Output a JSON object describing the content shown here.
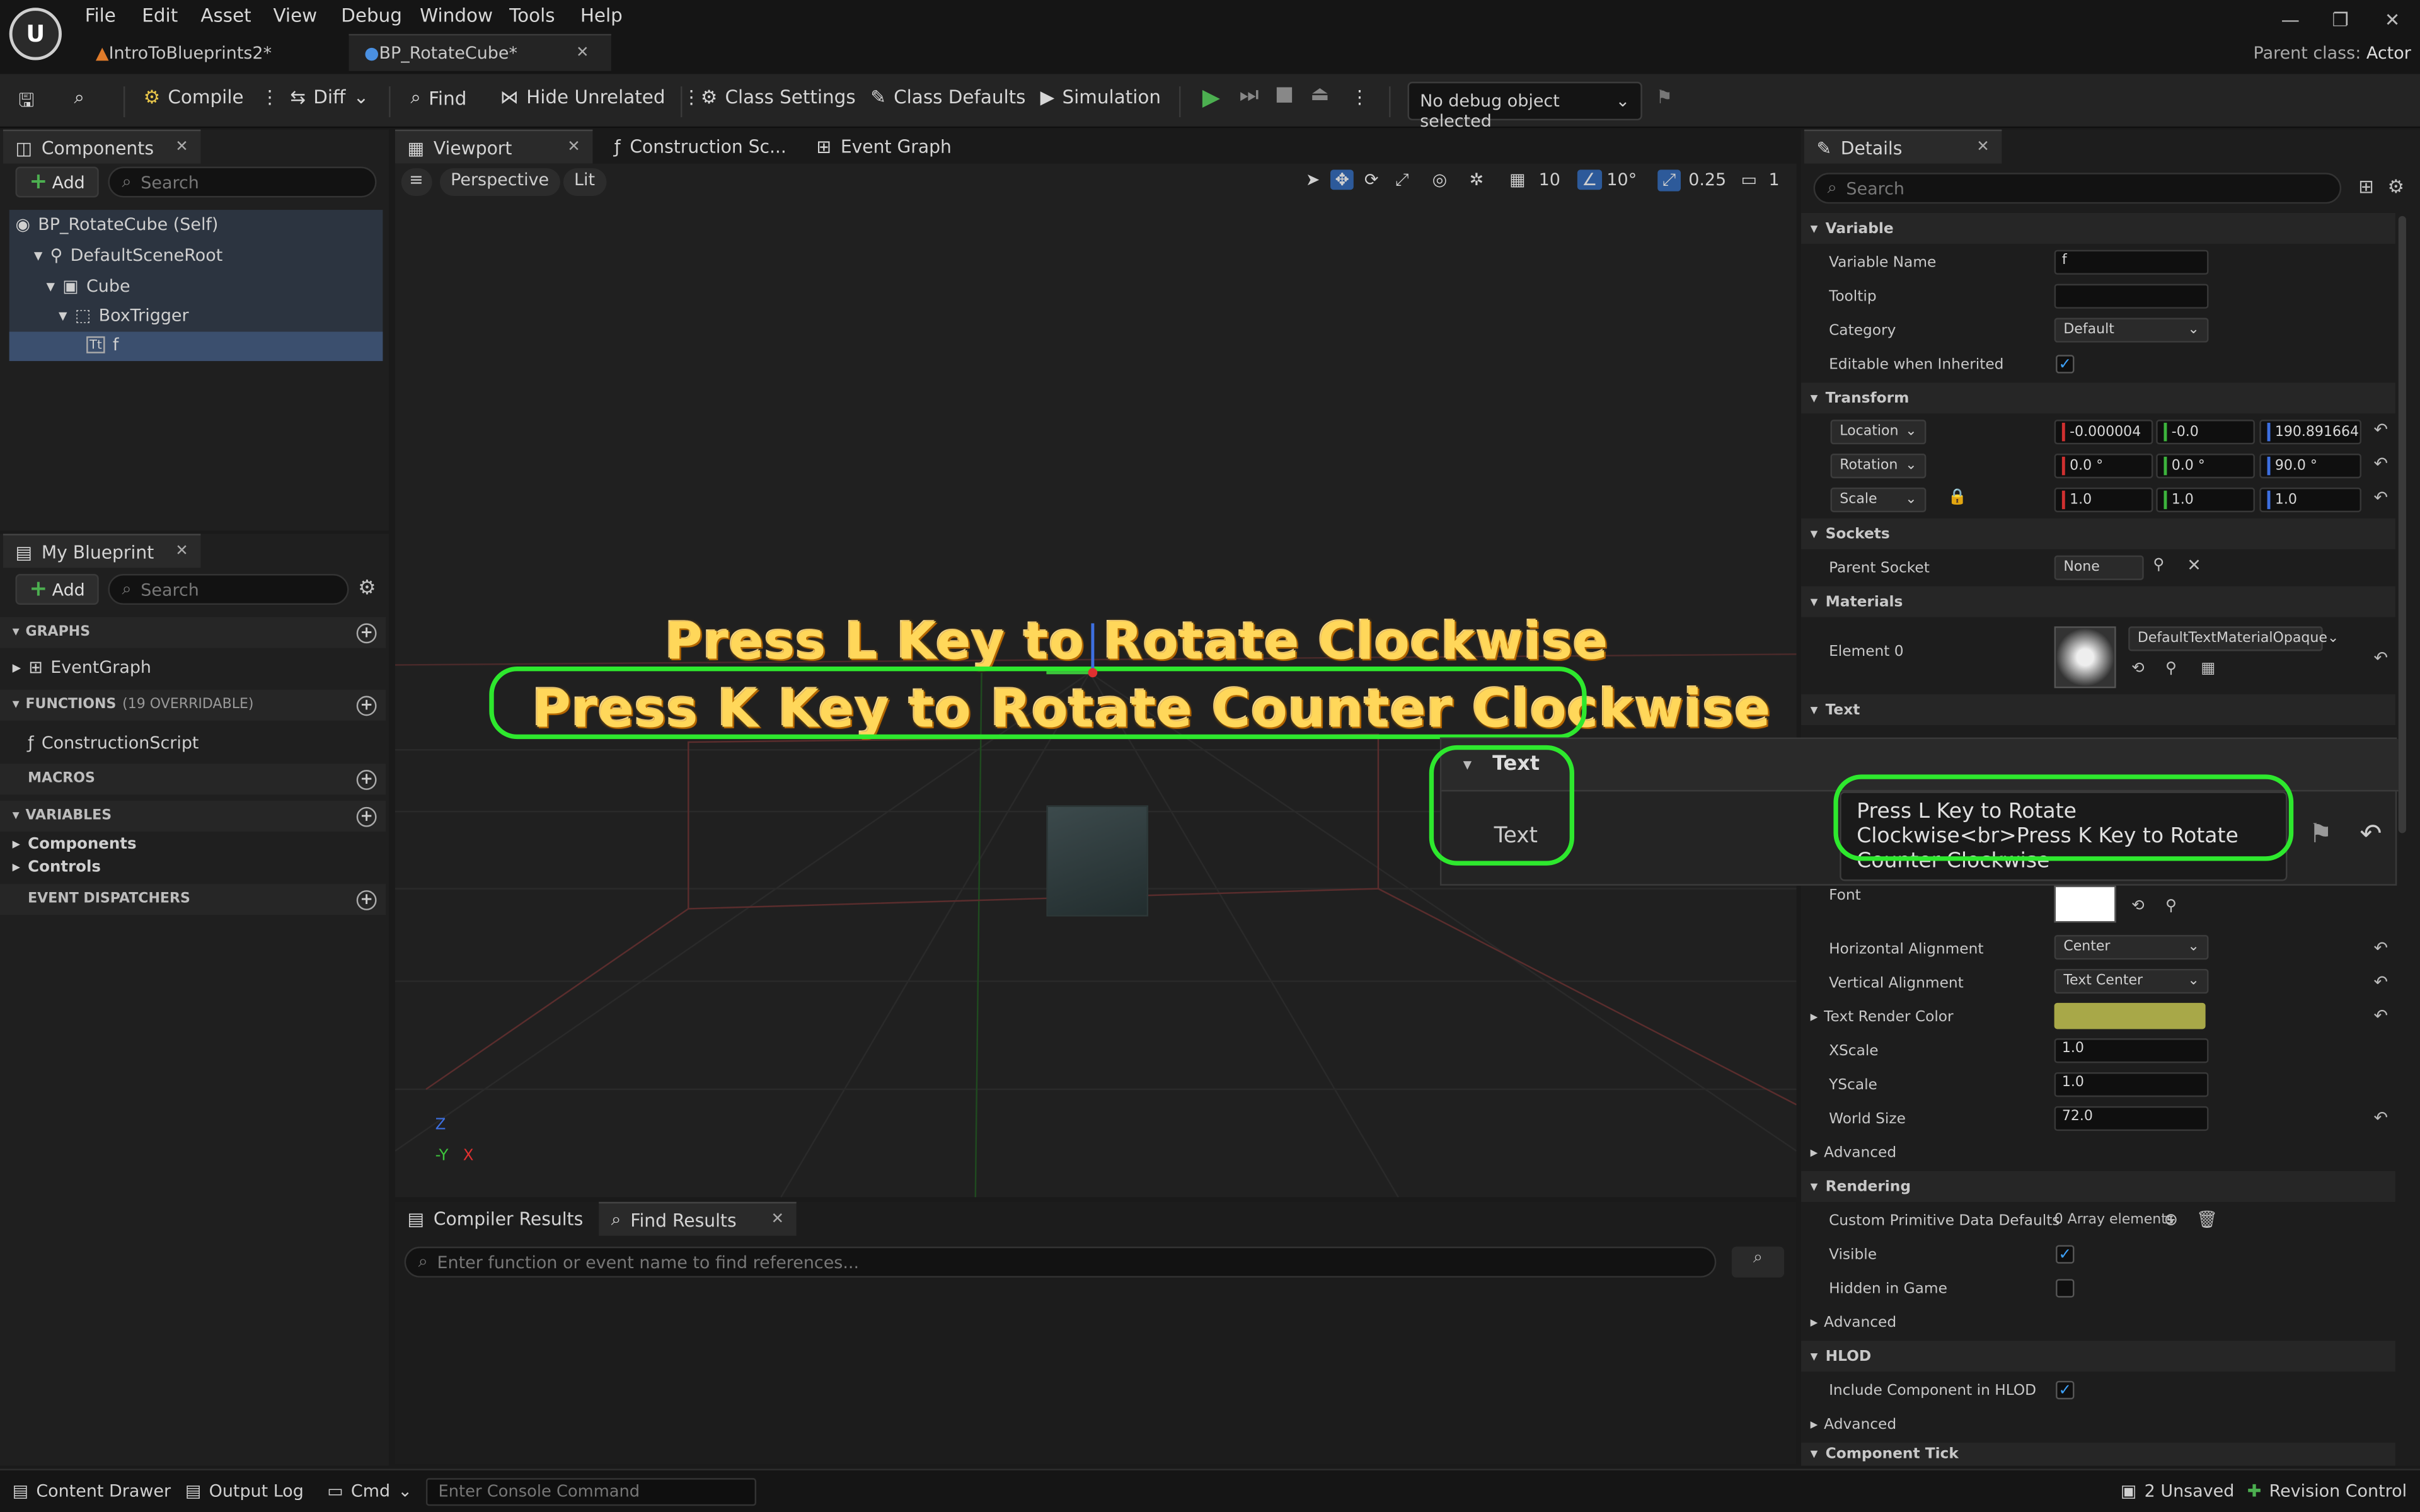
{
  "menu": {
    "items": [
      "File",
      "Edit",
      "Asset",
      "View",
      "Debug",
      "Window",
      "Tools",
      "Help"
    ]
  },
  "tabs": {
    "doc1": "IntroToBlueprints2*",
    "doc2": "BP_RotateCube*"
  },
  "parent_class": {
    "label": "Parent class:",
    "value": "Actor"
  },
  "toolbar": {
    "compile": "Compile",
    "diff": "Diff",
    "find": "Find",
    "hide_unrelated": "Hide Unrelated",
    "class_settings": "Class Settings",
    "class_defaults": "Class Defaults",
    "simulation": "Simulation",
    "debug_object": "No debug object selected"
  },
  "components": {
    "tab": "Components",
    "add": "Add",
    "search_placeholder": "Search",
    "tree": [
      "BP_RotateCube (Self)",
      "DefaultSceneRoot",
      "Cube",
      "BoxTrigger",
      "f"
    ]
  },
  "my_blueprint": {
    "tab": "My Blueprint",
    "add": "Add",
    "search_placeholder": "Search",
    "graphs": "GRAPHS",
    "event_graph": "EventGraph",
    "functions": "FUNCTIONS",
    "functions_count": "(19 OVERRIDABLE)",
    "construction_script": "ConstructionScript",
    "macros": "MACROS",
    "variables": "VARIABLES",
    "components": "Components",
    "controls": "Controls",
    "event_dispatchers": "EVENT DISPATCHERS"
  },
  "editor_tabs": {
    "viewport": "Viewport",
    "construction": "Construction Sc...",
    "event_graph": "Event Graph"
  },
  "viewport": {
    "perspective": "Perspective",
    "lit": "Lit",
    "grid": "10",
    "angle": "10°",
    "scale": "0.25",
    "camera": "1",
    "text_line1": "Press L Key to Rotate Clockwise",
    "text_line2": "Press K Key to Rotate Counter Clockwise",
    "axis_z": "Z",
    "axis_y": "-Y",
    "axis_x": "X"
  },
  "details": {
    "tab": "Details",
    "search_placeholder": "Search",
    "variable": {
      "section": "Variable",
      "name_label": "Variable Name",
      "name_value": "f",
      "tooltip_label": "Tooltip",
      "category_label": "Category",
      "category_value": "Default",
      "editable_label": "Editable when Inherited"
    },
    "transform": {
      "section": "Transform",
      "location": "Location",
      "rotation": "Rotation",
      "scale": "Scale",
      "loc": [
        "-0.000004",
        "-0.0",
        "190.891664"
      ],
      "rot": [
        "0.0 °",
        "0.0 °",
        "90.0 °"
      ],
      "scl": [
        "1.0",
        "1.0",
        "1.0"
      ]
    },
    "sockets": {
      "section": "Sockets",
      "parent_label": "Parent Socket",
      "parent_value": "None"
    },
    "materials": {
      "section": "Materials",
      "element_label": "Element 0",
      "material": "DefaultTextMaterialOpaque"
    },
    "text": {
      "section": "Text",
      "font_label": "Font",
      "halign_label": "Horizontal Alignment",
      "halign_value": "Center",
      "valign_label": "Vertical Alignment",
      "valign_value": "Text Center",
      "color_label": "Text Render Color",
      "text_render_color": "#a8a848",
      "xscale_label": "XScale",
      "xscale_value": "1.0",
      "yscale_label": "YScale",
      "yscale_value": "1.0",
      "world_size_label": "World Size",
      "world_size_value": "72.0",
      "advanced": "Advanced"
    },
    "rendering": {
      "section": "Rendering",
      "custom_label": "Custom Primitive Data Defaults",
      "custom_value": "0 Array elements",
      "visible_label": "Visible",
      "hidden_label": "Hidden in Game",
      "advanced": "Advanced"
    },
    "hlod": {
      "section": "HLOD",
      "include_label": "Include Component in HLOD",
      "advanced": "Advanced"
    },
    "component_tick": {
      "section": "Component Tick"
    }
  },
  "zoom_overlay": {
    "section": "Text",
    "label": "Text",
    "value": "Press L Key to Rotate Clockwise<br>Press K Key to Rotate Counter Clockwise"
  },
  "bottom": {
    "compiler_results": "Compiler Results",
    "find_results": "Find Results",
    "find_placeholder": "Enter function or event name to find references..."
  },
  "status": {
    "content_drawer": "Content Drawer",
    "output_log": "Output Log",
    "cmd": "Cmd",
    "console_placeholder": "Enter Console Command",
    "unsaved": "2 Unsaved",
    "revision": "Revision Control"
  },
  "colors": {
    "highlight_ring": "#2ee82e",
    "text_yellow": "#ffd75a",
    "play_green": "#4caf50",
    "accent_blue": "#3ea3ff"
  }
}
